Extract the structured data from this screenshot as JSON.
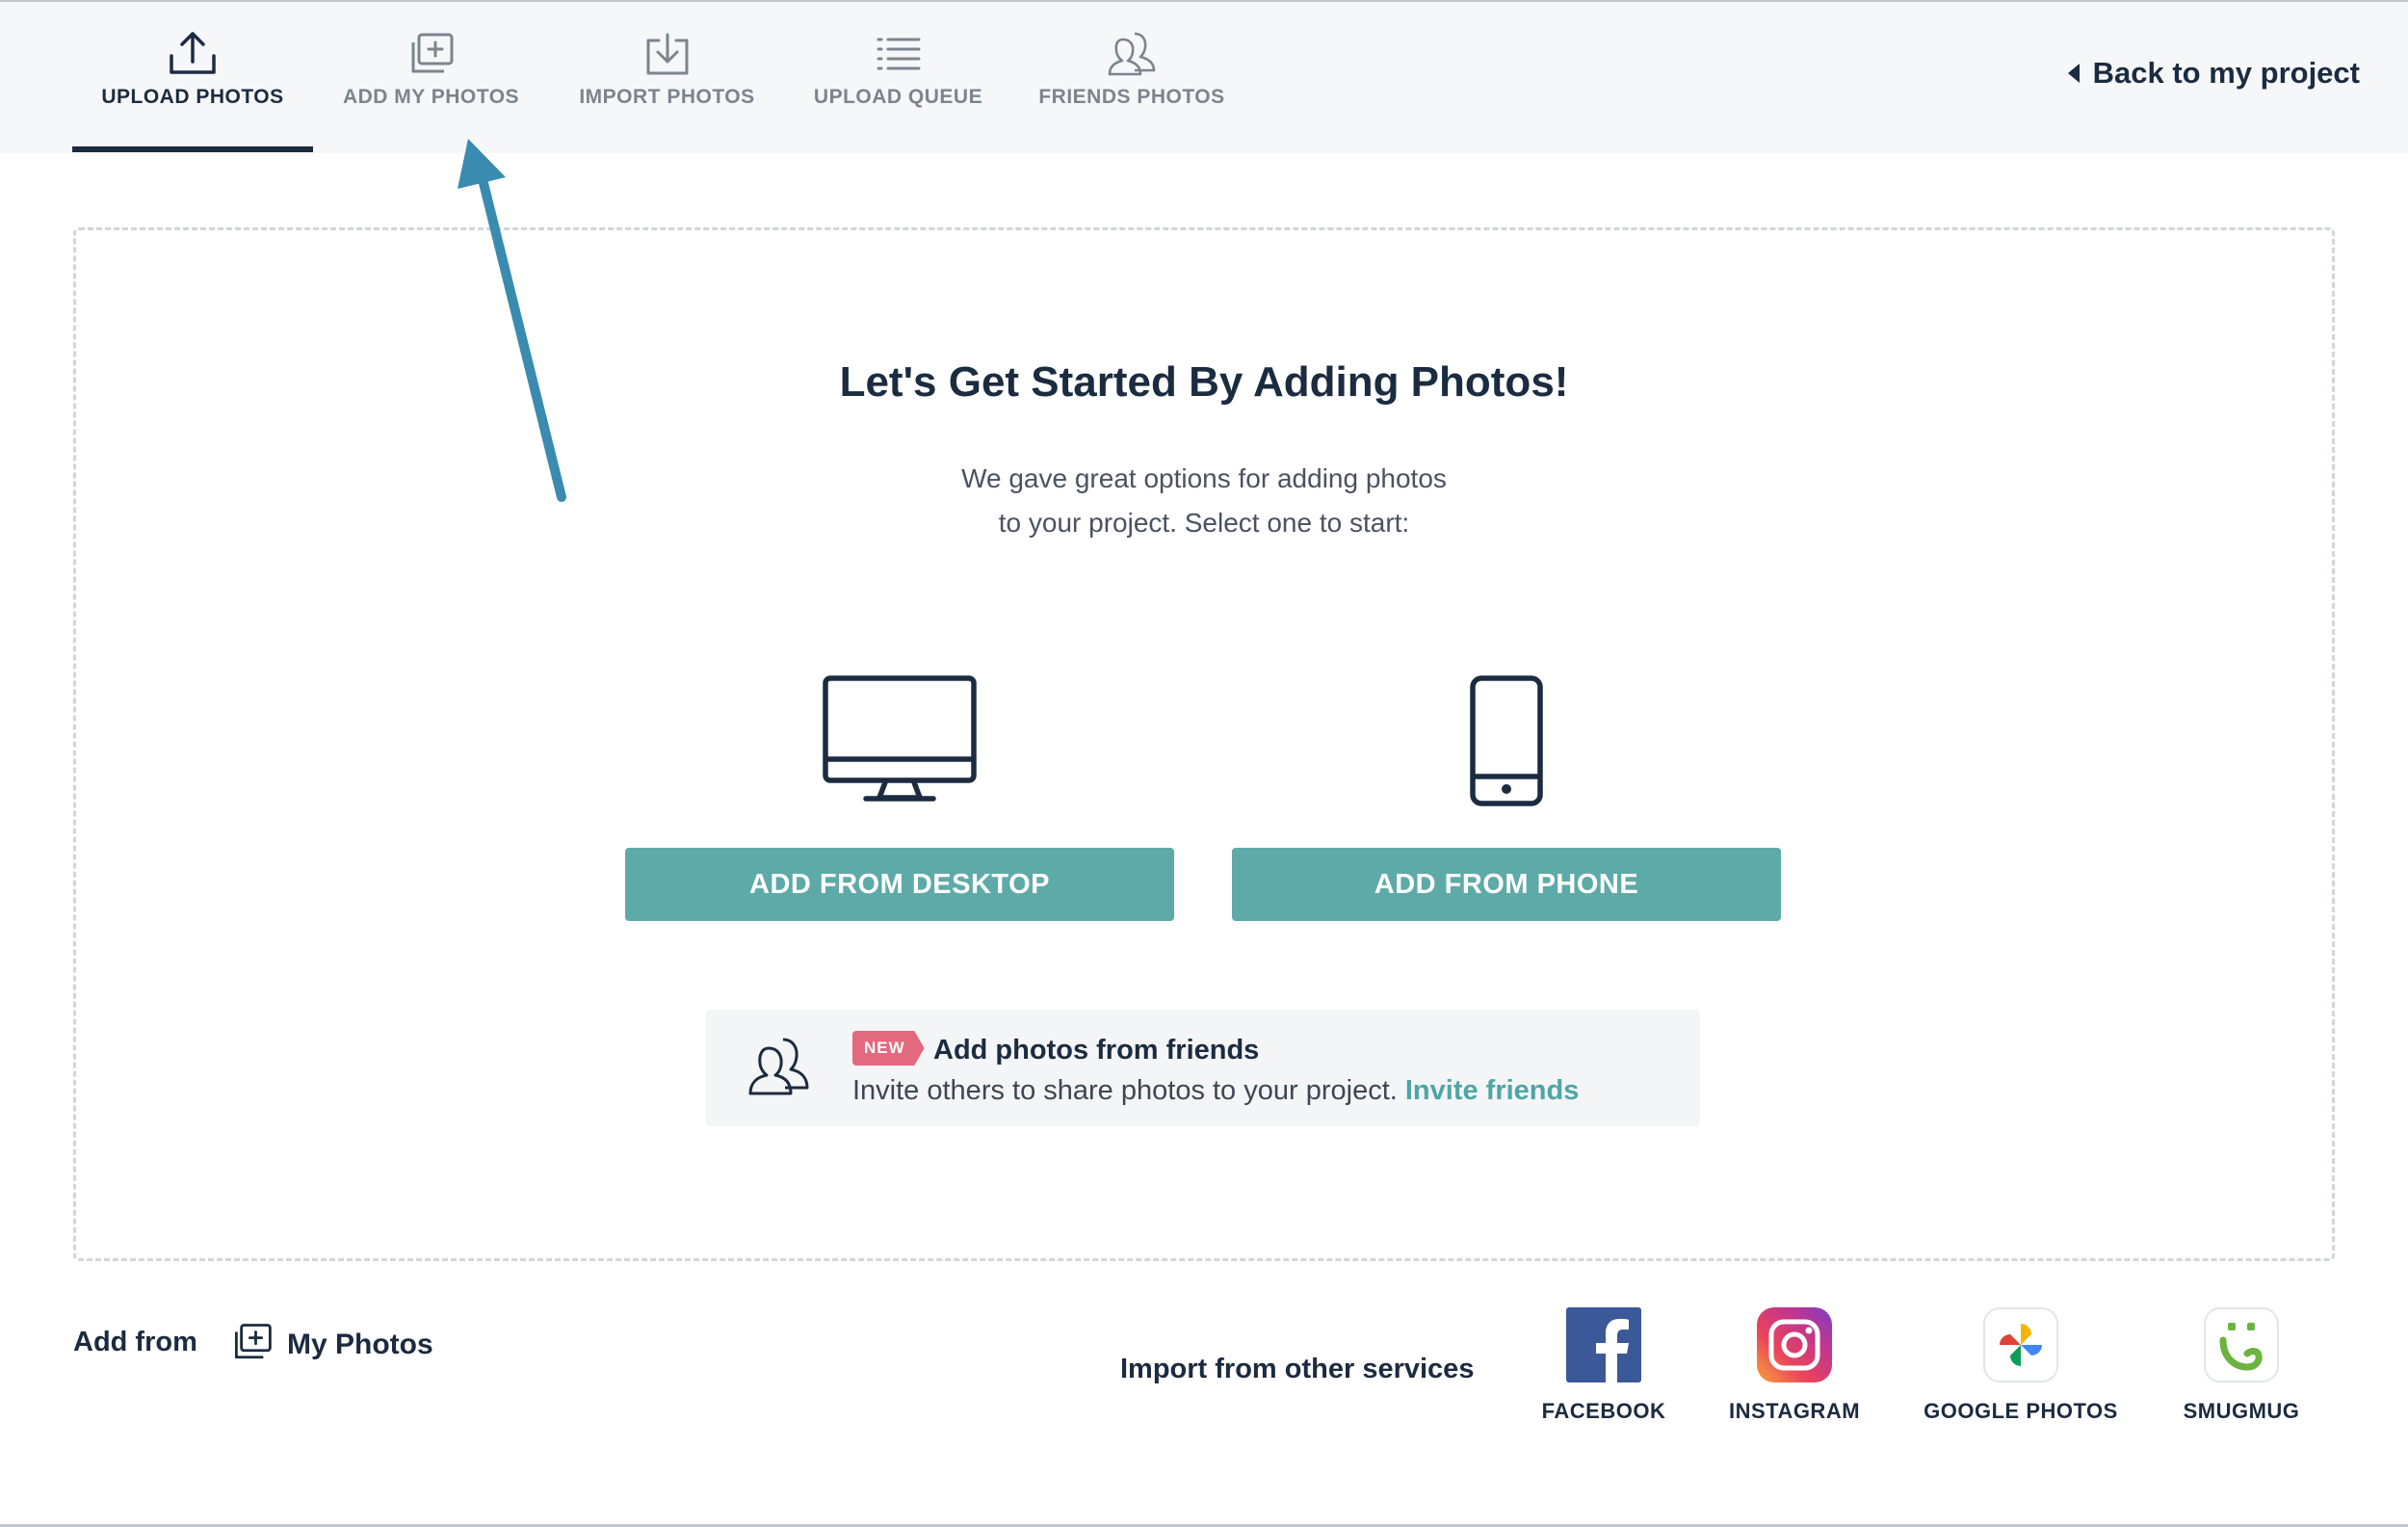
{
  "tabs": [
    {
      "label": "UPLOAD PHOTOS",
      "icon": "upload-icon",
      "active": true
    },
    {
      "label": "ADD MY PHOTOS",
      "icon": "add-photos-icon",
      "active": false
    },
    {
      "label": "IMPORT PHOTOS",
      "icon": "import-icon",
      "active": false
    },
    {
      "label": "UPLOAD QUEUE",
      "icon": "list-icon",
      "active": false
    },
    {
      "label": "FRIENDS PHOTOS",
      "icon": "friends-icon",
      "active": false
    }
  ],
  "header": {
    "back_label": "Back to my project"
  },
  "main": {
    "title": "Let's Get Started By Adding Photos!",
    "subtitle_line1": "We gave great options for adding photos",
    "subtitle_line2": "to your project. Select one to start:",
    "desktop_button": "ADD FROM DESKTOP",
    "phone_button": "ADD FROM PHONE"
  },
  "friends": {
    "badge": "NEW",
    "title": "Add photos from friends",
    "description": "Invite others to share photos to your project.",
    "link": "Invite friends"
  },
  "footer": {
    "add_from_label": "Add from",
    "my_photos_label": "My Photos",
    "import_label": "Import from other services",
    "services": [
      {
        "label": "FACEBOOK",
        "icon": "facebook-icon"
      },
      {
        "label": "INSTAGRAM",
        "icon": "instagram-icon"
      },
      {
        "label": "GOOGLE PHOTOS",
        "icon": "google-photos-icon"
      },
      {
        "label": "SMUGMUG",
        "icon": "smugmug-icon"
      }
    ]
  },
  "colors": {
    "accent": "#5eaaa8",
    "navy": "#1b2b40",
    "badge": "#e2697f",
    "arrow": "#3a8bb0"
  }
}
